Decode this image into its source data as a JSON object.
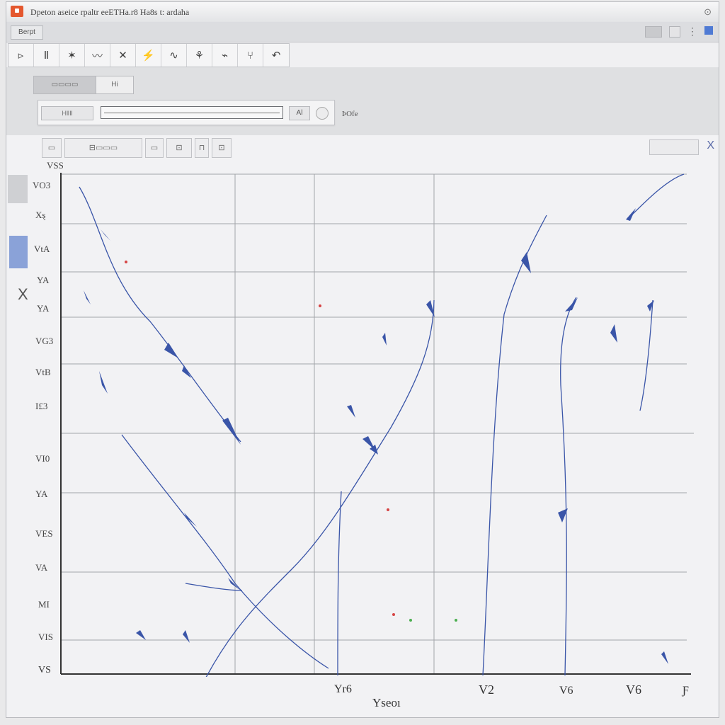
{
  "window": {
    "title": "Dpeton aseice rpaltr eeETHa.r8 Ha8s t: ardaha",
    "title_control": "⊙"
  },
  "menubar": {
    "item": "Berpt"
  },
  "toolbar": {
    "tools": [
      "▹",
      "Ⅱ",
      "✶",
      "〰",
      "✕",
      "⚡",
      "∿",
      "⚘",
      "⌁",
      "⑂",
      "↶"
    ]
  },
  "upper": {
    "seg_left": "▭▭▭▭",
    "seg_right": "Hi",
    "filter_left": "HⅡⅡ",
    "filter_btn": "Al",
    "filter_label": "ÞOfe"
  },
  "subtoolbar": {
    "items": [
      "▭",
      "⊟▭▭▭",
      "▭",
      "⊡",
      "⊓",
      "⊡"
    ]
  },
  "close_label": "X",
  "side_x": "X",
  "chart_data": {
    "type": "line",
    "y_ticks": [
      "VO3",
      "Xȿ",
      "VtA",
      "YA",
      "YA",
      "VG3",
      "VtB",
      "I£3",
      "VI0",
      "YA",
      "VES",
      "VA",
      "MI",
      "VIS",
      "VS"
    ],
    "y_top_label": "VSS",
    "x_ticks": [
      "Yr6",
      "V2",
      "V6",
      "V6",
      "Ƒ"
    ],
    "xlabel": "Yseoı",
    "colors": {
      "line": "#3a55a8",
      "grid": "#9a9ca2",
      "red": "#d64545",
      "green": "#4caf50"
    }
  }
}
